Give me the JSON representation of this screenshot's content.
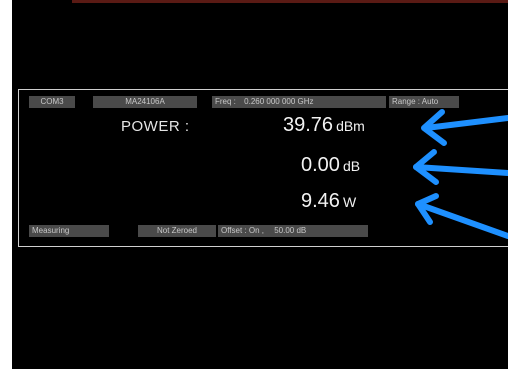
{
  "status_top": {
    "port": "COM3",
    "model": "MA24106A",
    "freq_label": "Freq :",
    "freq_value": "0.260 000 000 GHz",
    "range": "Range : Auto"
  },
  "readings": {
    "power_label": "POWER :",
    "dbm_value": "39.76",
    "dbm_unit": "dBm",
    "db_value": "0.00",
    "db_unit": "dB",
    "w_value": "9.46",
    "w_unit": "W"
  },
  "status_bottom": {
    "state": "Measuring",
    "zero": "Not Zeroed",
    "offset_label": "Offset : On ,",
    "offset_value": "50.00 dB"
  },
  "colors": {
    "background": "#000000",
    "chip": "#4a4a4a",
    "arrow": "#1e90ff"
  }
}
